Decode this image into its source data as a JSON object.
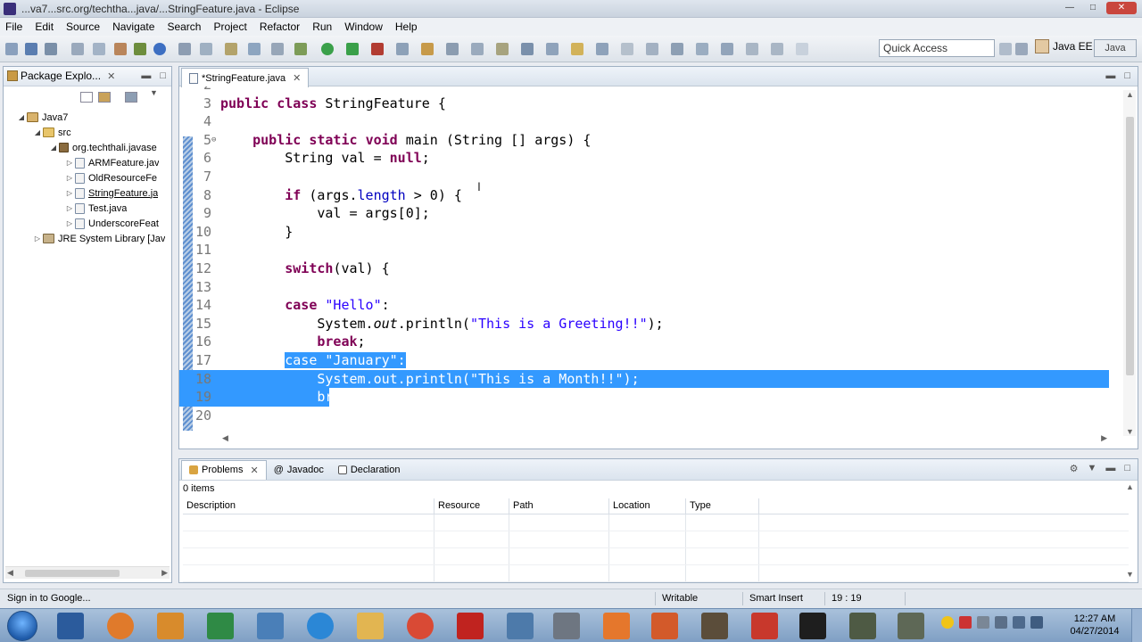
{
  "window": {
    "title": "...va7...src.org/techtha...java/...StringFeature.java - Eclipse"
  },
  "menu": [
    "File",
    "Edit",
    "Source",
    "Navigate",
    "Search",
    "Project",
    "Refactor",
    "Run",
    "Window",
    "Help"
  ],
  "toolbar": {
    "quick_access_placeholder": "Quick Access",
    "perspective_java": "Java EE",
    "perspective_other": "Java"
  },
  "package_explorer": {
    "tab_label": "Package Explo...",
    "tree": [
      {
        "label": "Java7",
        "icon": "project-icon",
        "level": 0,
        "expanded": true
      },
      {
        "label": "src",
        "icon": "folder-icon",
        "level": 1,
        "expanded": true
      },
      {
        "label": "org.techthali.javase",
        "icon": "package-icon",
        "level": 2,
        "expanded": true
      },
      {
        "label": "ARMFeature.jav",
        "icon": "java-file-icon",
        "level": 3,
        "expanded": false
      },
      {
        "label": "OldResourceFe",
        "icon": "java-file-icon",
        "level": 3,
        "expanded": false
      },
      {
        "label": "StringFeature.ja",
        "icon": "java-file-icon",
        "level": 3,
        "expanded": false
      },
      {
        "label": "Test.java",
        "icon": "java-file-icon",
        "level": 3,
        "expanded": false
      },
      {
        "label": "UnderscoreFeat",
        "icon": "java-file-icon",
        "level": 3,
        "expanded": false
      },
      {
        "label": "JRE System Library [Jav",
        "icon": "library-icon",
        "level": 0,
        "expanded": false
      }
    ]
  },
  "editor": {
    "tab_label": "*StringFeature.java",
    "lines": [
      {
        "n": "2",
        "text": ""
      },
      {
        "n": "3",
        "text": "public class StringFeature {"
      },
      {
        "n": "4",
        "text": ""
      },
      {
        "n": "5",
        "text": "    public static void main (String [] args) {"
      },
      {
        "n": "6",
        "text": "        String val = null;"
      },
      {
        "n": "7",
        "text": ""
      },
      {
        "n": "8",
        "text": "        if (args.length > 0) {"
      },
      {
        "n": "9",
        "text": "            val = args[0];"
      },
      {
        "n": "10",
        "text": "        }"
      },
      {
        "n": "11",
        "text": ""
      },
      {
        "n": "12",
        "text": "        switch(val) {"
      },
      {
        "n": "13",
        "text": ""
      },
      {
        "n": "14",
        "text": "        case \"Hello\":"
      },
      {
        "n": "15",
        "text": "            System.out.println(\"This is a Greeting!!\");"
      },
      {
        "n": "16",
        "text": "            break;"
      },
      {
        "n": "17",
        "text": "        case \"January\":"
      },
      {
        "n": "18",
        "text": "            System.out.println(\"This is a Month!!\");"
      },
      {
        "n": "19",
        "text": "            break;"
      },
      {
        "n": "20",
        "text": ""
      }
    ]
  },
  "bottom_panel": {
    "tabs": [
      "Problems",
      "Javadoc",
      "Declaration"
    ],
    "items_count": "0 items",
    "columns": [
      "Description",
      "Resource",
      "Path",
      "Location",
      "Type"
    ]
  },
  "status": {
    "sign_in": "Sign in to Google...",
    "writable": "Writable",
    "insert_mode": "Smart Insert",
    "position": "19 : 19"
  },
  "clock": {
    "time": "12:27 AM",
    "date": "04/27/2014"
  },
  "colors": {
    "keyword": "#7f0055",
    "string": "#2a00ff",
    "field": "#0000c0",
    "selection": "#3399ff"
  }
}
